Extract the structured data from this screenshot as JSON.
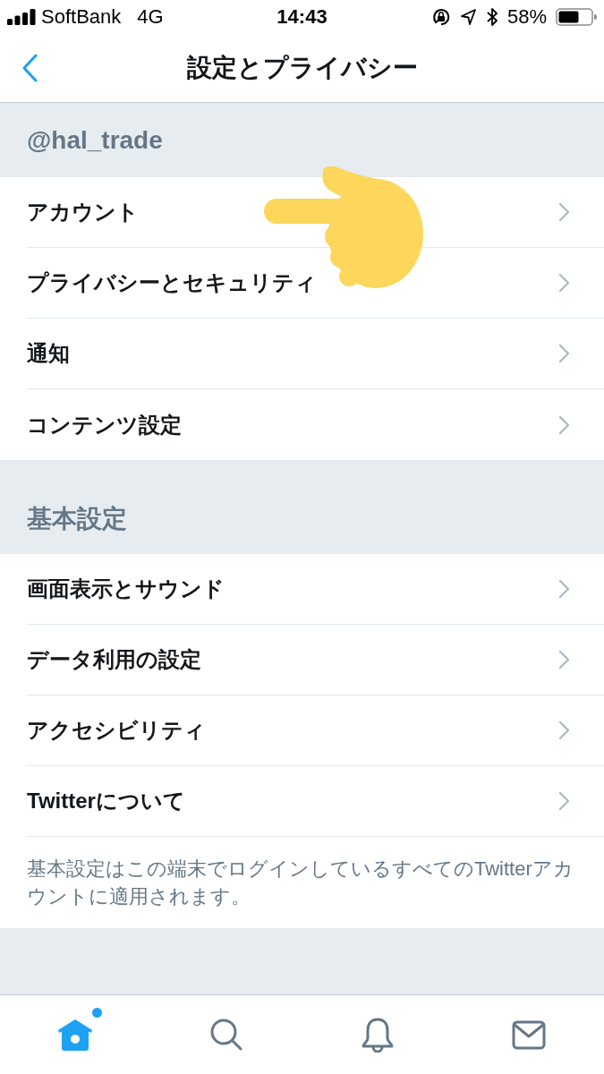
{
  "status_bar": {
    "carrier": "SoftBank",
    "network": "4G",
    "time": "14:43",
    "battery": "58%"
  },
  "nav_bar": {
    "title": "設定とプライバシー"
  },
  "sections": [
    {
      "header": "@hal_trade",
      "items": [
        "アカウント",
        "プライバシーとセキュリティ",
        "通知",
        "コンテンツ設定"
      ]
    },
    {
      "header": "基本設定",
      "items": [
        "画面表示とサウンド",
        "データ利用の設定",
        "アクセシビリティ",
        "Twitterについて"
      ],
      "note": "基本設定はこの端末でログインしているすべてのTwitterアカウントに適用されます。"
    }
  ],
  "tab_bar": [
    {
      "kind": "home",
      "selected": true,
      "badge": true
    },
    {
      "kind": "search",
      "selected": false,
      "badge": false
    },
    {
      "kind": "notifications",
      "selected": false,
      "badge": false
    },
    {
      "kind": "messages",
      "selected": false,
      "badge": false
    }
  ]
}
